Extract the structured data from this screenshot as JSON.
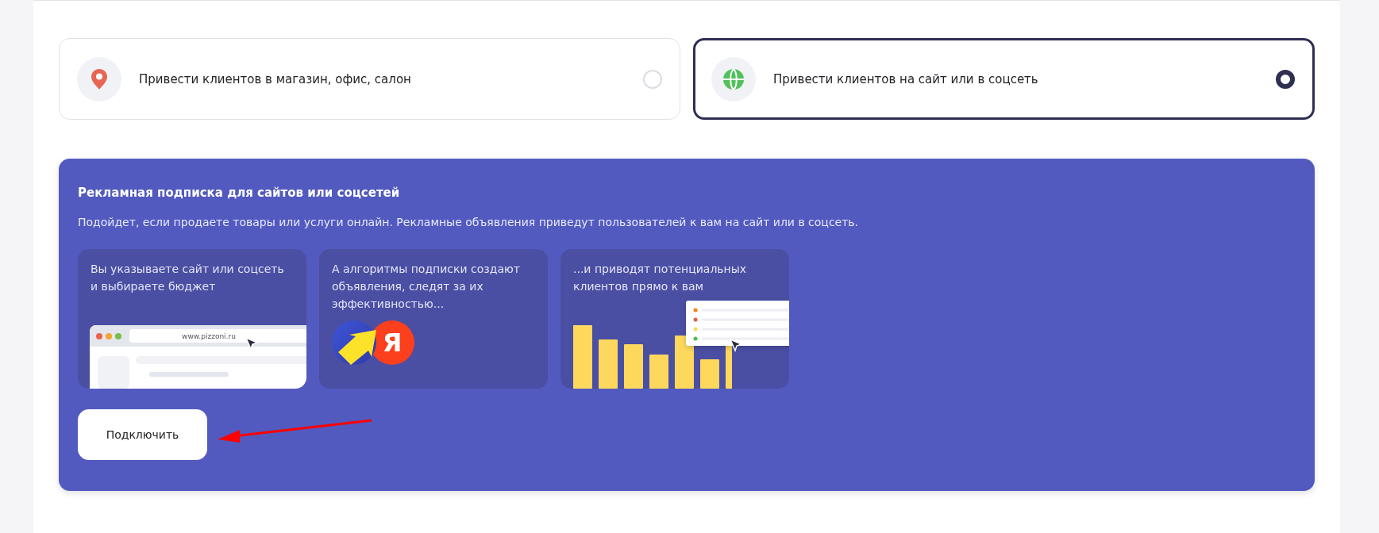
{
  "options": [
    {
      "kind": "pin",
      "label": "Привести клиентов в магазин, офис, салон",
      "selected": false
    },
    {
      "kind": "globe",
      "label": "Привести клиентов на сайт или в соцсеть",
      "selected": true
    }
  ],
  "panel": {
    "title": "Рекламная подписка для сайтов или соцсетей",
    "description": "Подойдет, если продаете товары или услуги онлайн. Рекламные объявления приведут пользователей к вам на сайт или в соцсеть.",
    "steps": [
      {
        "kind": "browser",
        "text": "Вы указываете сайт или соцсеть и выбираете бюджет",
        "url": "www.pizzoni.ru"
      },
      {
        "kind": "logos",
        "text": "А алгоритмы подписки создают объявления, следят за их эффективностью...",
        "logo_letter": "Я"
      },
      {
        "kind": "bars",
        "text": "...и приводят потенциальных клиентов прямо к вам"
      }
    ],
    "button": "Подключить"
  }
}
